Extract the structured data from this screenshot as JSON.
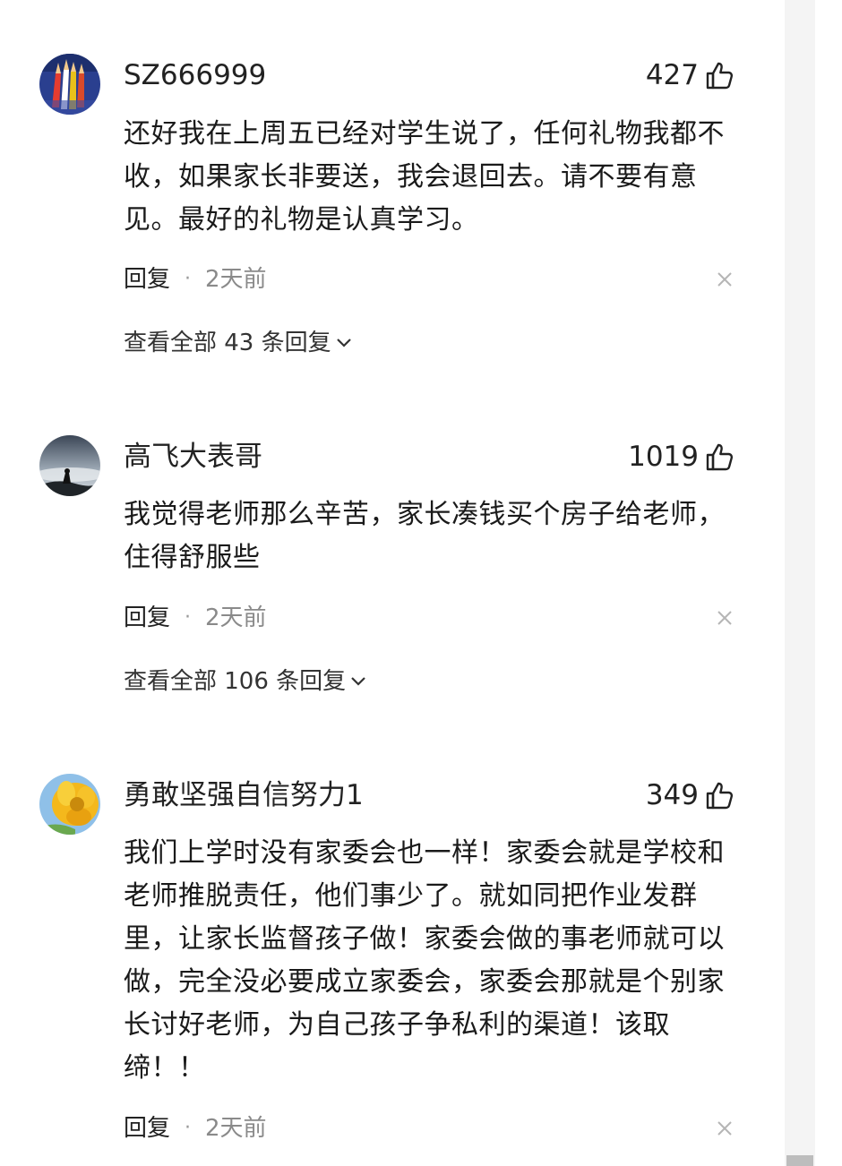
{
  "comments": [
    {
      "username": "SZ666999",
      "likes": "427",
      "text": "还好我在上周五已经对学生说了，任何礼物我都不收，如果家长非要送，我会退回去。请不要有意见。最好的礼物是认真学习。",
      "reply_label": "回复",
      "separator": "·",
      "time": "2天前",
      "view_all": "查看全部 43 条回复"
    },
    {
      "username": "高飞大表哥",
      "likes": "1019",
      "text": "我觉得老师那么辛苦，家长凑钱买个房子给老师，住得舒服些",
      "reply_label": "回复",
      "separator": "·",
      "time": "2天前",
      "view_all": "查看全部 106 条回复"
    },
    {
      "username": "勇敢坚强自信努力1",
      "likes": "349",
      "text": "我们上学时没有家委会也一样！家委会就是学校和老师推脱责任，他们事少了。就如同把作业发群里，让家长监督孩子做！家委会做的事老师就可以做，完全没必要成立家委会，家委会那就是个别家长讨好老师，为自己孩子争私利的渠道！该取缔！！",
      "reply_label": "回复",
      "separator": "·",
      "time": "2天前"
    }
  ],
  "icons": {
    "like": "thumbs-up-icon",
    "close": "close-icon",
    "expand": "chevron-down-icon"
  }
}
